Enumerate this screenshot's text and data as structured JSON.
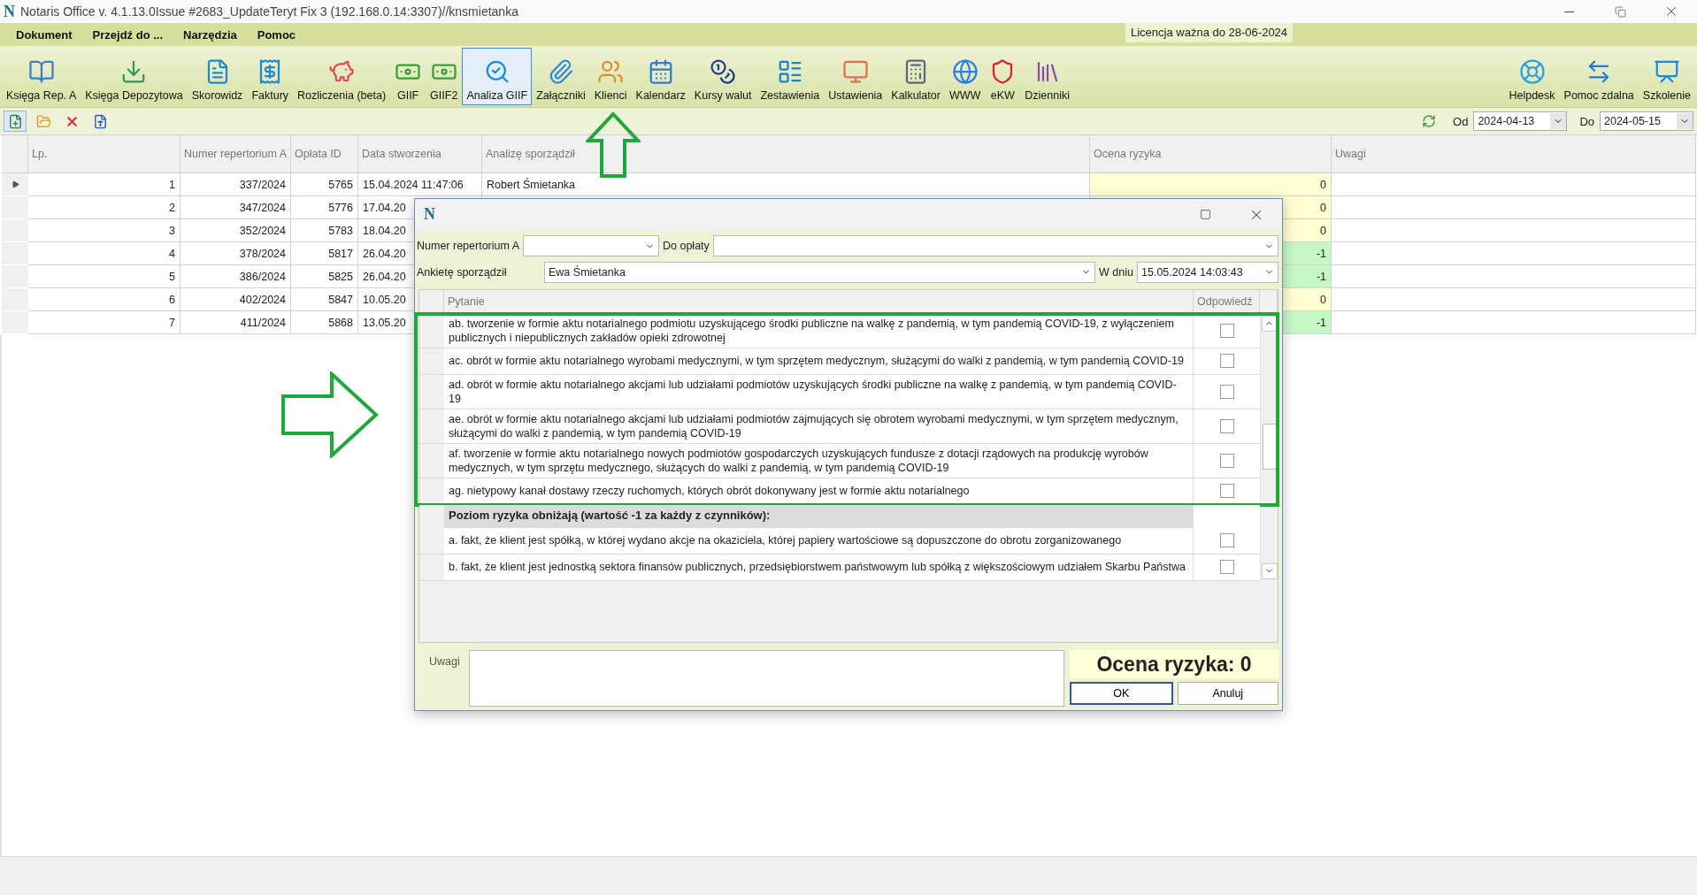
{
  "window": {
    "logo": "N",
    "title": "Notaris Office v. 4.1.13.0Issue #2683_UpdateTeryt Fix 3 (192.168.0.14:3307)//knsmietanka"
  },
  "menu": [
    "Dokument",
    "Przejdź do ...",
    "Narzędzia",
    "Pomoc"
  ],
  "license": "Licencja ważna do 28-06-2024",
  "toolbar": {
    "left": [
      {
        "label": "Księga Rep. A",
        "selected": false
      },
      {
        "label": "Księga Depozytowa",
        "selected": false
      },
      {
        "label": "Skorowidz",
        "selected": false
      },
      {
        "label": "Faktury",
        "selected": false
      },
      {
        "label": "Rozliczenia (beta)",
        "selected": false
      },
      {
        "label": "GIIF",
        "selected": false
      },
      {
        "label": "GIIF2",
        "selected": false
      },
      {
        "label": "Analiza GIIF",
        "selected": true
      },
      {
        "label": "Załączniki",
        "selected": false
      },
      {
        "label": "Klienci",
        "selected": false
      },
      {
        "label": "Kalendarz",
        "selected": false
      },
      {
        "label": "Kursy walut",
        "selected": false
      },
      {
        "label": "Zestawienia",
        "selected": false
      },
      {
        "label": "Ustawienia",
        "selected": false
      },
      {
        "label": "Kalkulator",
        "selected": false
      },
      {
        "label": "WWW",
        "selected": false
      },
      {
        "label": "eKW",
        "selected": false
      },
      {
        "label": "Dzienniki",
        "selected": false
      }
    ],
    "right": [
      {
        "label": "Helpdesk",
        "selected": false
      },
      {
        "label": "Pomoc zdalna",
        "selected": false
      },
      {
        "label": "Szkolenie",
        "selected": false
      }
    ]
  },
  "filter": {
    "from_label": "Od",
    "from": "2024-04-13",
    "to_label": "Do",
    "to": "2024-05-15"
  },
  "table": {
    "columns": [
      "Lp.",
      "Numer repertorium A",
      "Opłata ID",
      "Data stworzenia",
      "Analizę sporządził",
      "Ocena ryzyka",
      "Uwagi"
    ],
    "rows": [
      {
        "selected": true,
        "lp": "1",
        "numer": "337/2024",
        "oplata": "5765",
        "data": "15.04.2024 11:47:06",
        "analize": "Robert Śmietanka",
        "ocena": "0",
        "color": "#fffed2"
      },
      {
        "selected": false,
        "lp": "2",
        "numer": "347/2024",
        "oplata": "5776",
        "data": "17.04.20",
        "ocena": "0",
        "color": "#fffed2"
      },
      {
        "selected": false,
        "lp": "3",
        "numer": "352/2024",
        "oplata": "5783",
        "data": "18.04.20",
        "ocena": "0",
        "color": "#fffed2"
      },
      {
        "selected": false,
        "lp": "4",
        "numer": "378/2024",
        "oplata": "5817",
        "data": "26.04.20",
        "ocena": "-1",
        "color": "#c6f8c6"
      },
      {
        "selected": false,
        "lp": "5",
        "numer": "386/2024",
        "oplata": "5825",
        "data": "26.04.20",
        "ocena": "-1",
        "color": "#c6f8c6"
      },
      {
        "selected": false,
        "lp": "6",
        "numer": "402/2024",
        "oplata": "5847",
        "data": "10.05.20",
        "ocena": "0",
        "color": "#fffed2"
      },
      {
        "selected": false,
        "lp": "7",
        "numer": "411/2024",
        "oplata": "5868",
        "data": "13.05.20",
        "ocena": "-1",
        "color": "#c6f8c6"
      }
    ]
  },
  "dialog": {
    "logo": "N",
    "numer_label": "Numer repertorium A",
    "do_oplaty_label": "Do opłaty",
    "ankiete_label": "Ankietę sporządził",
    "ankiete_value": "Ewa Śmietanka",
    "w_dniu_label": "W dniu",
    "w_dniu_value": "15.05.2024 14:03:43",
    "grid": {
      "columns": [
        "Pytanie",
        "Odpowiedź"
      ],
      "rows": [
        {
          "kind": "question",
          "highlighted": true,
          "checked": false,
          "text": "ab. tworzenie w formie aktu notarialnego podmiotu uzyskującego środki publiczne na walkę z pandemią, w tym pandemią COVID-19, z wyłączeniem publicznych i niepublicznych zakładów opieki zdrowotnej"
        },
        {
          "kind": "question",
          "highlighted": true,
          "checked": false,
          "text": "ac. obrót w formie aktu notarialnego wyrobami medycznymi, w tym sprzętem medycznym, służącymi do walki z pandemią, w tym pandemią COVID-19"
        },
        {
          "kind": "question",
          "highlighted": true,
          "checked": false,
          "text": "ad. obrót w formie aktu notarialnego akcjami lub udziałami podmiotów uzyskujących środki publiczne na walkę z pandemią, w tym pandemią COVID-19"
        },
        {
          "kind": "question",
          "highlighted": true,
          "checked": false,
          "text": "ae. obrót w formie aktu notarialnego akcjami lub udziałami podmiotów zajmujących się obrotem wyrobami medycznymi, w tym sprzętem medycznym, służącymi do walki z pandemią, w tym pandemią COVID-19"
        },
        {
          "kind": "question",
          "highlighted": true,
          "checked": false,
          "text": "af. tworzenie w formie aktu notarialnego nowych podmiotów gospodarczych uzyskujących fundusze z dotacji rządowych na produkcję wyrobów medycznych, w tym sprzętu medycznego, służących do walki z pandemią, w tym pandemią COVID-19"
        },
        {
          "kind": "question",
          "highlighted": true,
          "checked": false,
          "text": "ag. nietypowy kanał dostawy rzeczy ruchomych, których obrót dokonywany jest w formie aktu notarialnego"
        },
        {
          "kind": "section",
          "highlighted": false,
          "text": "Poziom ryzyka obniżają (wartość -1 za każdy z czynników):"
        },
        {
          "kind": "question",
          "highlighted": false,
          "checked": false,
          "text": "a. fakt, że klient jest spółką, w której wydano akcje na okaziciela, której papiery wartościowe są dopuszczone do obrotu zorganizowanego"
        },
        {
          "kind": "question",
          "highlighted": false,
          "checked": false,
          "text": "b. fakt, że klient jest jednostką sektora finansów publicznych, przedsiębiorstwem państwowym lub spółką z większościowym udziałem Skarbu Państwa"
        }
      ]
    },
    "uwagi_label": "Uwagi",
    "risk_score": "Ocena ryzyka: 0",
    "buttons": [
      {
        "label": "OK",
        "default": true
      },
      {
        "label": "Anuluj",
        "default": false
      }
    ]
  }
}
